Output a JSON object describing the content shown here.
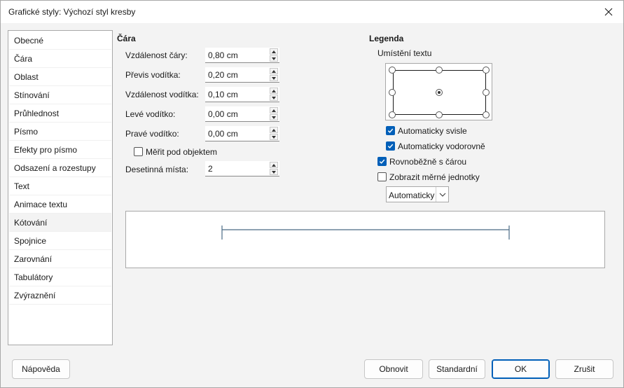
{
  "window": {
    "title": "Grafické styly: Výchozí styl kresby"
  },
  "sidebar": {
    "items": [
      {
        "label": "Obecné"
      },
      {
        "label": "Čára"
      },
      {
        "label": "Oblast"
      },
      {
        "label": "Stínování"
      },
      {
        "label": "Průhlednost"
      },
      {
        "label": "Písmo"
      },
      {
        "label": "Efekty pro písmo"
      },
      {
        "label": "Odsazení a rozestupy"
      },
      {
        "label": "Text"
      },
      {
        "label": "Animace textu"
      },
      {
        "label": "Kótování"
      },
      {
        "label": "Spojnice"
      },
      {
        "label": "Zarovnání"
      },
      {
        "label": "Tabulátory"
      },
      {
        "label": "Zvýraznění"
      }
    ],
    "selected": "Kótování"
  },
  "line_section": {
    "title": "Čára",
    "fields": [
      {
        "label": "Vzdálenost čáry:",
        "value": "0,80 cm"
      },
      {
        "label": "Převis vodítka:",
        "value": "0,20 cm"
      },
      {
        "label": "Vzdálenost vodítka:",
        "value": "0,10 cm"
      },
      {
        "label": "Levé vodítko:",
        "value": "0,00 cm"
      },
      {
        "label": "Pravé vodítko:",
        "value": "0,00 cm"
      }
    ],
    "measure_below": {
      "label": "Měřit pod objektem",
      "checked": false
    },
    "decimal": {
      "label": "Desetinná místa:",
      "value": "2"
    }
  },
  "legend_section": {
    "title": "Legenda",
    "text_position_label": "Umístění textu",
    "selected_position": "center",
    "auto_vertical": {
      "label": "Automaticky svisle",
      "checked": true
    },
    "auto_horizontal": {
      "label": "Automaticky vodorovně",
      "checked": true
    },
    "parallel": {
      "label": "Rovnoběžně s čárou",
      "checked": true
    },
    "show_units": {
      "label": "Zobrazit měrné jednotky",
      "checked": false
    },
    "units_dropdown": {
      "value": "Automaticky"
    }
  },
  "buttons": {
    "help": "Nápověda",
    "reset": "Obnovit",
    "standard": "Standardní",
    "ok": "OK",
    "cancel": "Zrušit"
  },
  "colors": {
    "accent": "#005fb8",
    "preview_line": "#4a6a85"
  }
}
